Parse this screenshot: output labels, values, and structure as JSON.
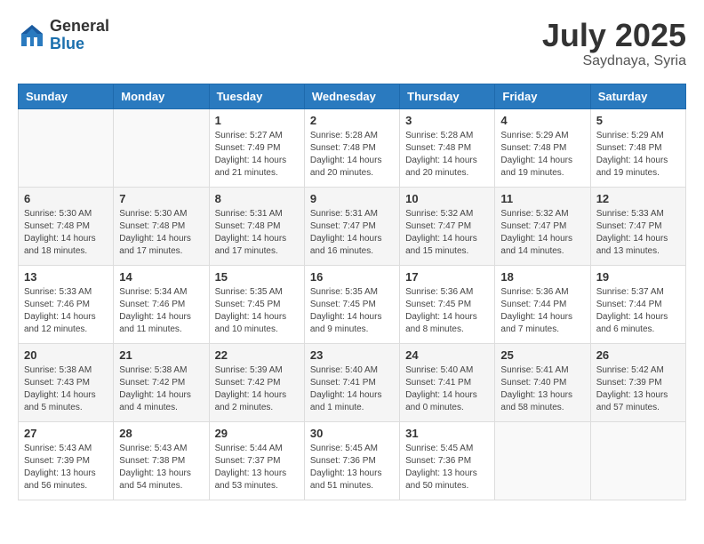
{
  "header": {
    "logo_general": "General",
    "logo_blue": "Blue",
    "month_title": "July 2025",
    "location": "Saydnaya, Syria"
  },
  "weekdays": [
    "Sunday",
    "Monday",
    "Tuesday",
    "Wednesday",
    "Thursday",
    "Friday",
    "Saturday"
  ],
  "weeks": [
    [
      {
        "day": "",
        "info": ""
      },
      {
        "day": "",
        "info": ""
      },
      {
        "day": "1",
        "info": "Sunrise: 5:27 AM\nSunset: 7:49 PM\nDaylight: 14 hours and 21 minutes."
      },
      {
        "day": "2",
        "info": "Sunrise: 5:28 AM\nSunset: 7:48 PM\nDaylight: 14 hours and 20 minutes."
      },
      {
        "day": "3",
        "info": "Sunrise: 5:28 AM\nSunset: 7:48 PM\nDaylight: 14 hours and 20 minutes."
      },
      {
        "day": "4",
        "info": "Sunrise: 5:29 AM\nSunset: 7:48 PM\nDaylight: 14 hours and 19 minutes."
      },
      {
        "day": "5",
        "info": "Sunrise: 5:29 AM\nSunset: 7:48 PM\nDaylight: 14 hours and 19 minutes."
      }
    ],
    [
      {
        "day": "6",
        "info": "Sunrise: 5:30 AM\nSunset: 7:48 PM\nDaylight: 14 hours and 18 minutes."
      },
      {
        "day": "7",
        "info": "Sunrise: 5:30 AM\nSunset: 7:48 PM\nDaylight: 14 hours and 17 minutes."
      },
      {
        "day": "8",
        "info": "Sunrise: 5:31 AM\nSunset: 7:48 PM\nDaylight: 14 hours and 17 minutes."
      },
      {
        "day": "9",
        "info": "Sunrise: 5:31 AM\nSunset: 7:47 PM\nDaylight: 14 hours and 16 minutes."
      },
      {
        "day": "10",
        "info": "Sunrise: 5:32 AM\nSunset: 7:47 PM\nDaylight: 14 hours and 15 minutes."
      },
      {
        "day": "11",
        "info": "Sunrise: 5:32 AM\nSunset: 7:47 PM\nDaylight: 14 hours and 14 minutes."
      },
      {
        "day": "12",
        "info": "Sunrise: 5:33 AM\nSunset: 7:47 PM\nDaylight: 14 hours and 13 minutes."
      }
    ],
    [
      {
        "day": "13",
        "info": "Sunrise: 5:33 AM\nSunset: 7:46 PM\nDaylight: 14 hours and 12 minutes."
      },
      {
        "day": "14",
        "info": "Sunrise: 5:34 AM\nSunset: 7:46 PM\nDaylight: 14 hours and 11 minutes."
      },
      {
        "day": "15",
        "info": "Sunrise: 5:35 AM\nSunset: 7:45 PM\nDaylight: 14 hours and 10 minutes."
      },
      {
        "day": "16",
        "info": "Sunrise: 5:35 AM\nSunset: 7:45 PM\nDaylight: 14 hours and 9 minutes."
      },
      {
        "day": "17",
        "info": "Sunrise: 5:36 AM\nSunset: 7:45 PM\nDaylight: 14 hours and 8 minutes."
      },
      {
        "day": "18",
        "info": "Sunrise: 5:36 AM\nSunset: 7:44 PM\nDaylight: 14 hours and 7 minutes."
      },
      {
        "day": "19",
        "info": "Sunrise: 5:37 AM\nSunset: 7:44 PM\nDaylight: 14 hours and 6 minutes."
      }
    ],
    [
      {
        "day": "20",
        "info": "Sunrise: 5:38 AM\nSunset: 7:43 PM\nDaylight: 14 hours and 5 minutes."
      },
      {
        "day": "21",
        "info": "Sunrise: 5:38 AM\nSunset: 7:42 PM\nDaylight: 14 hours and 4 minutes."
      },
      {
        "day": "22",
        "info": "Sunrise: 5:39 AM\nSunset: 7:42 PM\nDaylight: 14 hours and 2 minutes."
      },
      {
        "day": "23",
        "info": "Sunrise: 5:40 AM\nSunset: 7:41 PM\nDaylight: 14 hours and 1 minute."
      },
      {
        "day": "24",
        "info": "Sunrise: 5:40 AM\nSunset: 7:41 PM\nDaylight: 14 hours and 0 minutes."
      },
      {
        "day": "25",
        "info": "Sunrise: 5:41 AM\nSunset: 7:40 PM\nDaylight: 13 hours and 58 minutes."
      },
      {
        "day": "26",
        "info": "Sunrise: 5:42 AM\nSunset: 7:39 PM\nDaylight: 13 hours and 57 minutes."
      }
    ],
    [
      {
        "day": "27",
        "info": "Sunrise: 5:43 AM\nSunset: 7:39 PM\nDaylight: 13 hours and 56 minutes."
      },
      {
        "day": "28",
        "info": "Sunrise: 5:43 AM\nSunset: 7:38 PM\nDaylight: 13 hours and 54 minutes."
      },
      {
        "day": "29",
        "info": "Sunrise: 5:44 AM\nSunset: 7:37 PM\nDaylight: 13 hours and 53 minutes."
      },
      {
        "day": "30",
        "info": "Sunrise: 5:45 AM\nSunset: 7:36 PM\nDaylight: 13 hours and 51 minutes."
      },
      {
        "day": "31",
        "info": "Sunrise: 5:45 AM\nSunset: 7:36 PM\nDaylight: 13 hours and 50 minutes."
      },
      {
        "day": "",
        "info": ""
      },
      {
        "day": "",
        "info": ""
      }
    ]
  ]
}
